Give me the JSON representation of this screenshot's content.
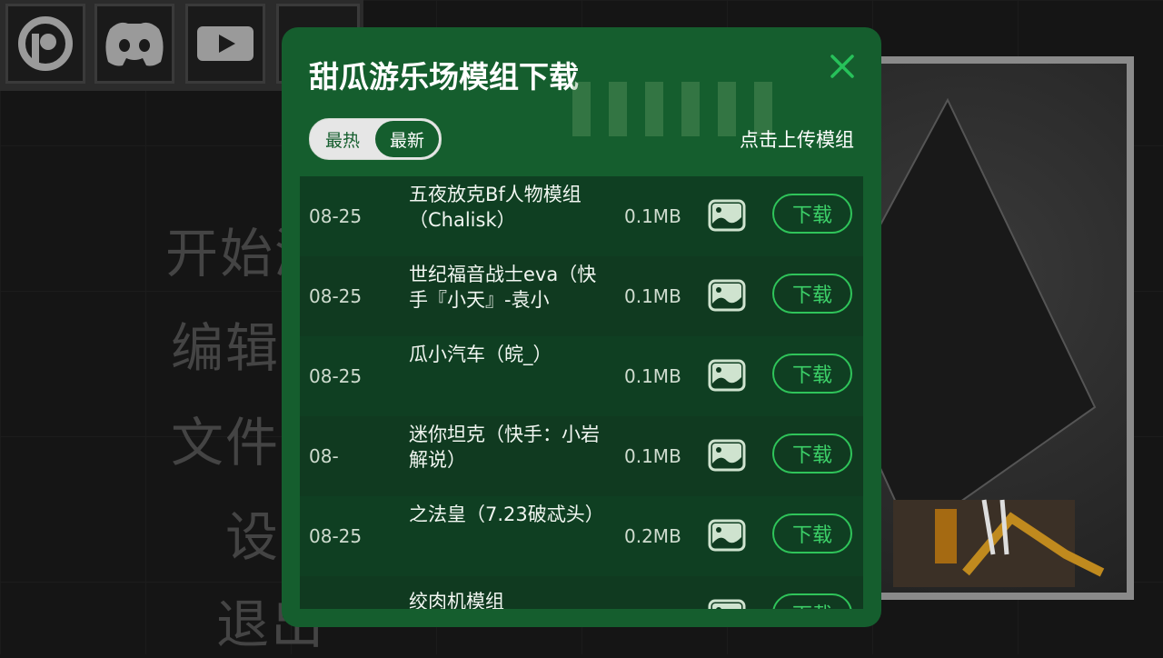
{
  "background_menu": {
    "items": [
      "开始游",
      "编辑模",
      "文件管",
      "设置",
      "退出"
    ]
  },
  "social_icons": [
    "patreon-icon",
    "discord-icon",
    "youtube-icon",
    "gear-icon"
  ],
  "dialog": {
    "title": "甜瓜游乐场模组下载",
    "tabs": {
      "hot": "最热",
      "new": "最新",
      "active": "new"
    },
    "upload_label": "点击上传模组",
    "download_label": "下载",
    "rows": [
      {
        "date": "08-25",
        "name": "五夜放克Bf人物模组（Chalisk）",
        "size": "0.1MB"
      },
      {
        "date": "08-25",
        "name": "世纪福音战士eva（快手『小天』-袁小",
        "size": "0.1MB"
      },
      {
        "date": "08-25",
        "name": "瓜小汽车（皖_）",
        "size": "0.1MB"
      },
      {
        "date": "08-",
        "name": "迷你坦克（快手：小岩解说）",
        "size": "0.1MB"
      },
      {
        "date": "08-25",
        "name": "之法皇（7.23破忒头）",
        "size": "0.2MB"
      },
      {
        "date": "",
        "name": "绞肉机模组",
        "size": ""
      }
    ]
  },
  "colors": {
    "dialog_bg": "#155e2e",
    "accent_green": "#2fc45a",
    "close_icon": "#27c25a"
  }
}
